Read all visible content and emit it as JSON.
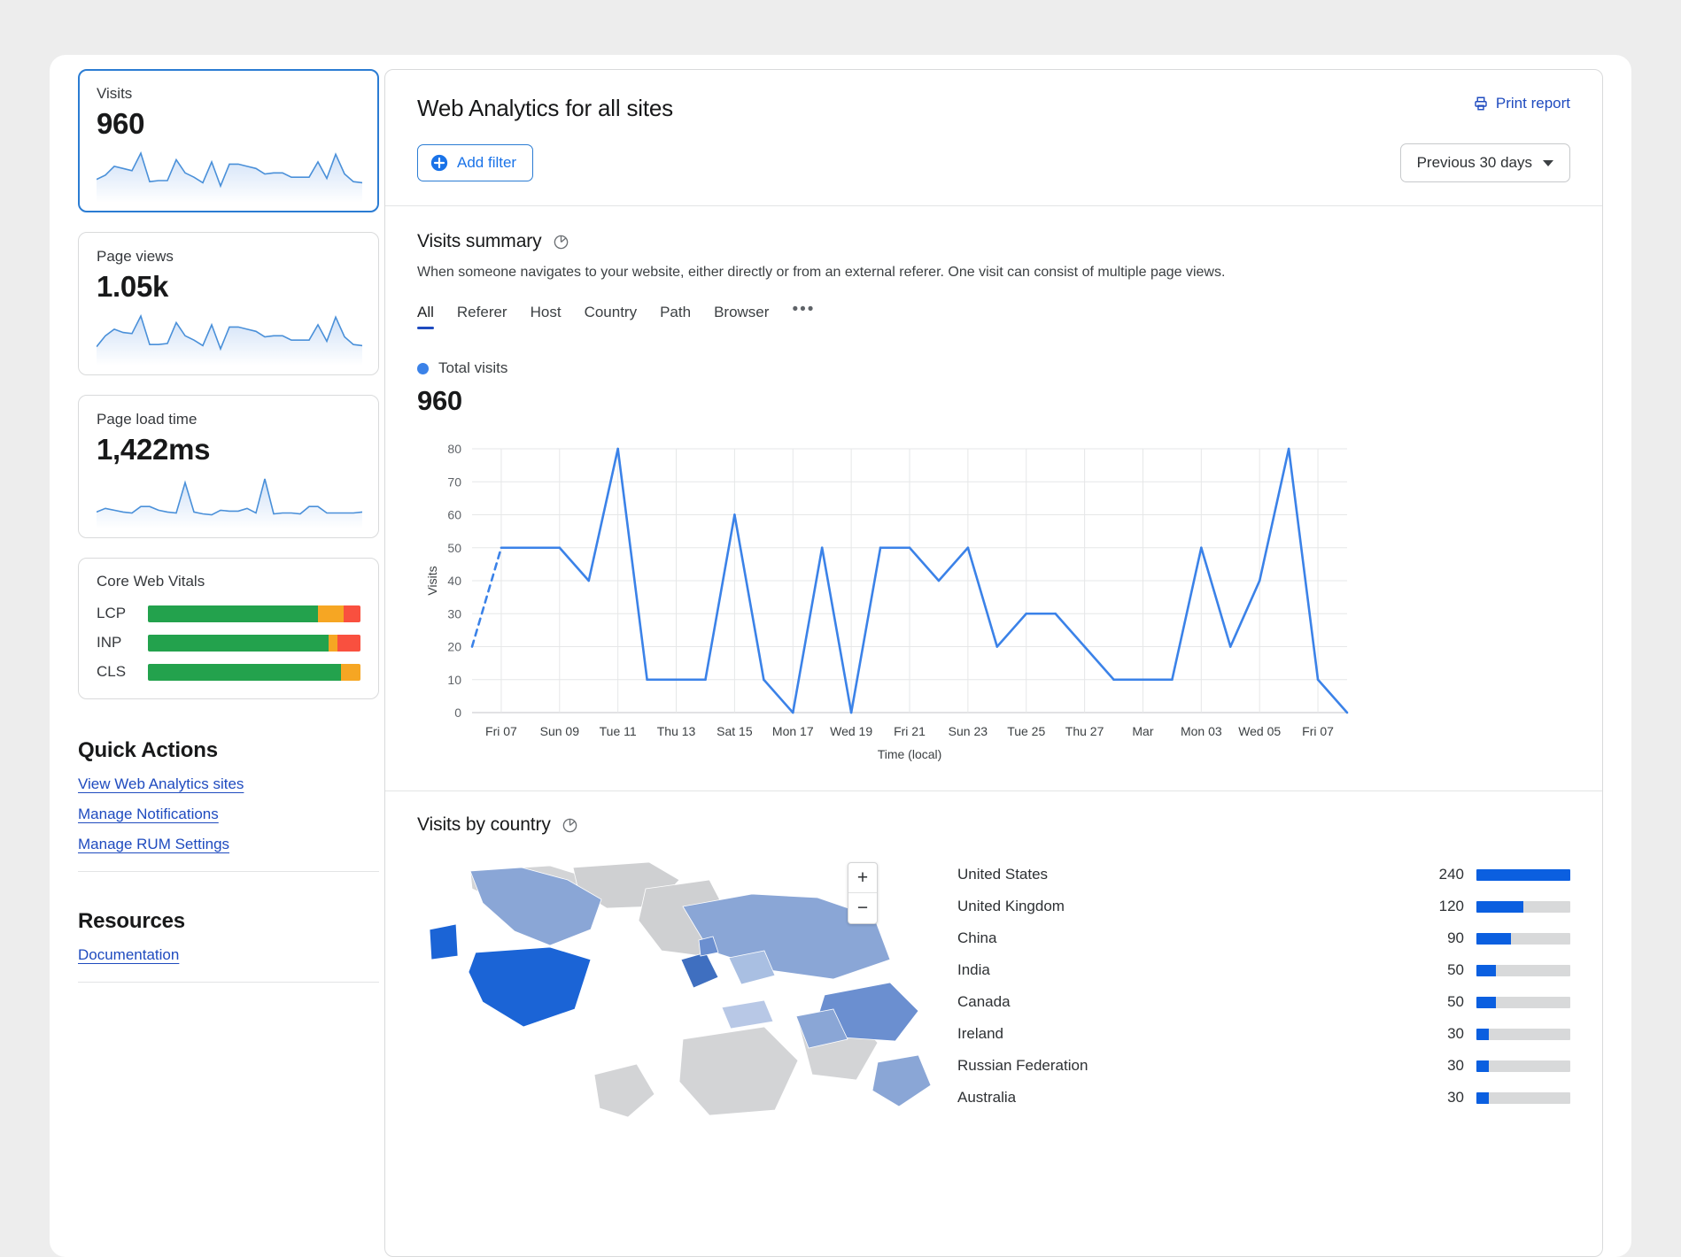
{
  "sidebar": {
    "metrics": [
      {
        "label": "Visits",
        "value": "960",
        "selected": true,
        "spark": [
          18,
          22,
          30,
          28,
          26,
          42,
          16,
          17,
          17,
          36,
          24,
          20,
          15,
          34,
          12,
          32,
          32,
          30,
          28,
          23,
          24,
          24,
          20,
          20,
          20,
          34,
          19,
          41,
          23,
          16,
          15
        ]
      },
      {
        "label": "Page views",
        "value": "1.05k",
        "selected": false,
        "spark": [
          14,
          24,
          30,
          27,
          26,
          42,
          16,
          16,
          17,
          36,
          24,
          20,
          15,
          34,
          12,
          32,
          32,
          30,
          28,
          23,
          24,
          24,
          20,
          20,
          20,
          34,
          19,
          41,
          23,
          16,
          15
        ]
      },
      {
        "label": "Page load time",
        "value": "1,422ms",
        "selected": false,
        "spark": [
          14,
          18,
          16,
          14,
          13,
          20,
          20,
          16,
          14,
          13,
          46,
          14,
          12,
          11,
          16,
          15,
          15,
          18,
          13,
          50,
          12,
          13,
          13,
          12,
          20,
          20,
          13,
          13,
          13,
          13,
          14
        ]
      }
    ],
    "cwv": {
      "title": "Core Web Vitals",
      "rows": [
        {
          "key": "LCP",
          "good": 80,
          "needs": 12,
          "poor": 8
        },
        {
          "key": "INP",
          "good": 85,
          "needs": 4,
          "poor": 11
        },
        {
          "key": "CLS",
          "good": 91,
          "needs": 9,
          "poor": 0
        }
      ],
      "colors": {
        "good": "#23a24d",
        "needs": "#f6a623",
        "poor": "#f9503f"
      }
    },
    "quick_actions": {
      "title": "Quick Actions",
      "links": [
        "View Web Analytics sites",
        "Manage Notifications",
        "Manage RUM Settings"
      ]
    },
    "resources": {
      "title": "Resources",
      "links": [
        "Documentation"
      ]
    }
  },
  "header": {
    "title": "Web Analytics for all sites",
    "print_label": "Print report",
    "add_filter_label": "Add filter",
    "date_range": "Previous 30 days"
  },
  "visits_summary": {
    "title": "Visits summary",
    "description": "When someone navigates to your website, either directly or from an external referer. One visit can consist of multiple page views.",
    "tabs": [
      "All",
      "Referer",
      "Host",
      "Country",
      "Path",
      "Browser"
    ],
    "active_tab": "All",
    "overflow": "•••",
    "legend_label": "Total visits",
    "legend_value": "960"
  },
  "country_panel": {
    "title": "Visits by country",
    "zoom_in": "+",
    "zoom_out": "−",
    "rows": [
      {
        "name": "United States",
        "value": "240",
        "pct": 100
      },
      {
        "name": "United Kingdom",
        "value": "120",
        "pct": 50
      },
      {
        "name": "China",
        "value": "90",
        "pct": 37
      },
      {
        "name": "India",
        "value": "50",
        "pct": 21
      },
      {
        "name": "Canada",
        "value": "50",
        "pct": 21
      },
      {
        "name": "Ireland",
        "value": "30",
        "pct": 13
      },
      {
        "name": "Russian Federation",
        "value": "30",
        "pct": 13
      },
      {
        "name": "Australia",
        "value": "30",
        "pct": 13
      }
    ],
    "bar_color": "#0b5fe0"
  },
  "chart_data": {
    "type": "line",
    "title": "Total visits",
    "xlabel": "Time (local)",
    "ylabel": "Visits",
    "ylim": [
      0,
      80
    ],
    "yticks": [
      0,
      10,
      20,
      30,
      40,
      50,
      60,
      70,
      80
    ],
    "grid": true,
    "line_color": "#3b82e8",
    "tick_labels": [
      "Fri 07",
      "Sun 09",
      "Tue 11",
      "Thu 13",
      "Sat 15",
      "Mon 17",
      "Wed 19",
      "Fri 21",
      "Sun 23",
      "Tue 25",
      "Thu 27",
      "Mar",
      "Mon 03",
      "Wed 05",
      "Fri 07"
    ],
    "series": [
      {
        "name": "Total visits",
        "x": [
          0,
          1,
          2,
          3,
          4,
          5,
          6,
          7,
          8,
          9,
          10,
          11,
          12,
          13,
          14,
          15,
          16,
          17,
          18,
          19,
          20,
          21,
          22,
          23,
          24,
          25,
          26,
          27,
          28,
          29,
          30,
          31
        ],
        "values": [
          20,
          50,
          50,
          50,
          40,
          80,
          10,
          10,
          10,
          60,
          10,
          0,
          50,
          0,
          50,
          50,
          40,
          50,
          20,
          30,
          30,
          20,
          10,
          10,
          10,
          50,
          20,
          40,
          80,
          10,
          0
        ],
        "dashed_segments": [
          [
            0,
            1
          ],
          [
            30,
            31
          ]
        ]
      }
    ]
  }
}
